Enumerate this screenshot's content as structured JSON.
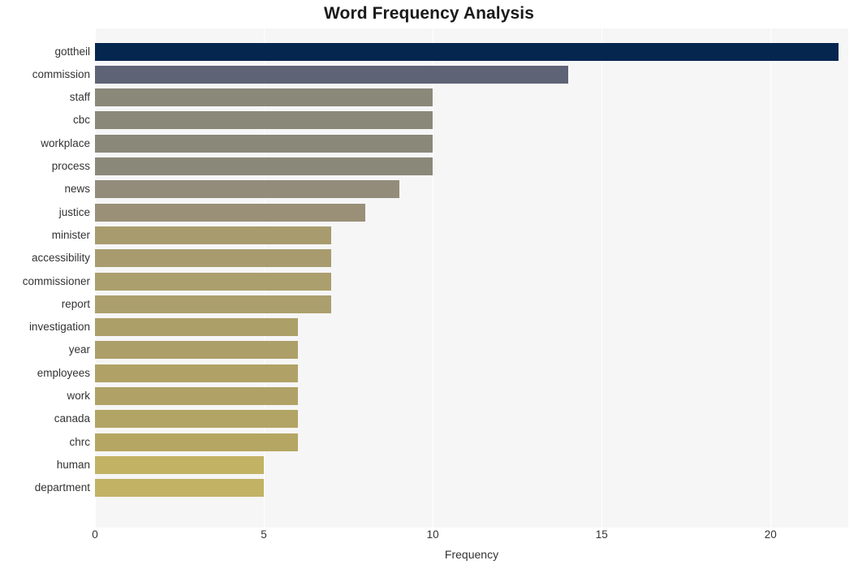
{
  "chart_data": {
    "type": "bar",
    "orientation": "horizontal",
    "title": "Word Frequency Analysis",
    "xlabel": "Frequency",
    "ylabel": "",
    "xlim": [
      0,
      22.3
    ],
    "xticks": [
      "0",
      "5",
      "10",
      "15",
      "20"
    ],
    "xtick_values": [
      0,
      5,
      10,
      15,
      20
    ],
    "grid": "vertical-white",
    "legend": "none",
    "background": "#f6f6f7",
    "categories": [
      "gottheil",
      "commission",
      "staff",
      "cbc",
      "workplace",
      "process",
      "news",
      "justice",
      "minister",
      "accessibility",
      "commissioner",
      "report",
      "investigation",
      "year",
      "employees",
      "work",
      "canada",
      "chrc",
      "human",
      "department"
    ],
    "values": [
      22,
      14,
      10,
      10,
      10,
      10,
      9,
      8,
      7,
      7,
      7,
      7,
      6,
      6,
      6,
      6,
      6,
      6,
      5,
      5
    ],
    "colors": [
      "#04264f",
      "#5f6376",
      "#8a8878",
      "#8a8878",
      "#8a8878",
      "#8a8878",
      "#938c7a",
      "#9a9077",
      "#a89c6e",
      "#a89c6e",
      "#ab9f6d",
      "#ab9f6d",
      "#ad9f68",
      "#ad9f68",
      "#b0a266",
      "#b0a266",
      "#b2a464",
      "#b5a763",
      "#c2b264",
      "#c2b264"
    ]
  }
}
